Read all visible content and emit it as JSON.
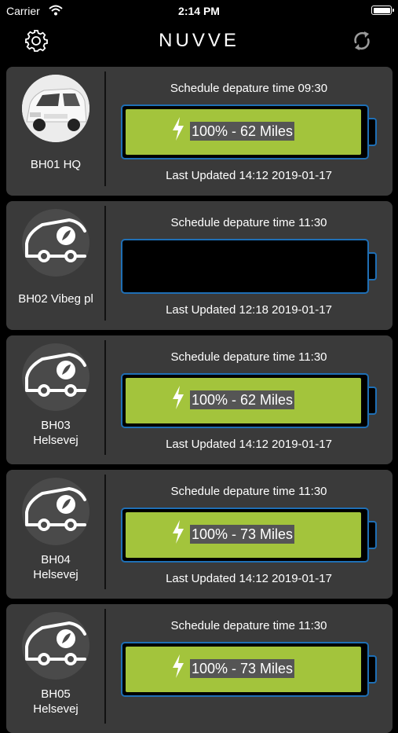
{
  "status_bar": {
    "carrier": "Carrier",
    "time": "2:14 PM"
  },
  "header": {
    "logo": "NUVVE"
  },
  "colors": {
    "battery_fill": "#a3c43c",
    "battery_border": "#1f6fb5",
    "card_bg": "#3a3a3a"
  },
  "vehicles": [
    {
      "name": "BH01 HQ",
      "image": "white-van-photo",
      "schedule": "Schedule depature time  09:30",
      "charge_label": "100% - 62 Miles",
      "charge_level": 1.0,
      "updated": "Last Updated 14:12 2019-01-17"
    },
    {
      "name": "BH02 Vibeg pl",
      "image": "van-placeholder-icon",
      "schedule": "Schedule depature time  11:30",
      "charge_label": "",
      "charge_level": 0,
      "updated": "Last Updated 12:18 2019-01-17"
    },
    {
      "name": "BH03 Helsevej",
      "image": "van-placeholder-icon",
      "schedule": "Schedule depature time  11:30",
      "charge_label": "100% - 62 Miles",
      "charge_level": 1.0,
      "updated": "Last Updated 14:12 2019-01-17"
    },
    {
      "name": "BH04 Helsevej",
      "image": "van-placeholder-icon",
      "schedule": "Schedule depature time  11:30",
      "charge_label": "100% - 73 Miles",
      "charge_level": 1.0,
      "updated": "Last Updated 14:12 2019-01-17"
    },
    {
      "name": "BH05 Helsevej",
      "image": "van-placeholder-icon",
      "schedule": "Schedule depature time  11:30",
      "charge_label": "100% - 73 Miles",
      "charge_level": 1.0,
      "updated": ""
    }
  ]
}
